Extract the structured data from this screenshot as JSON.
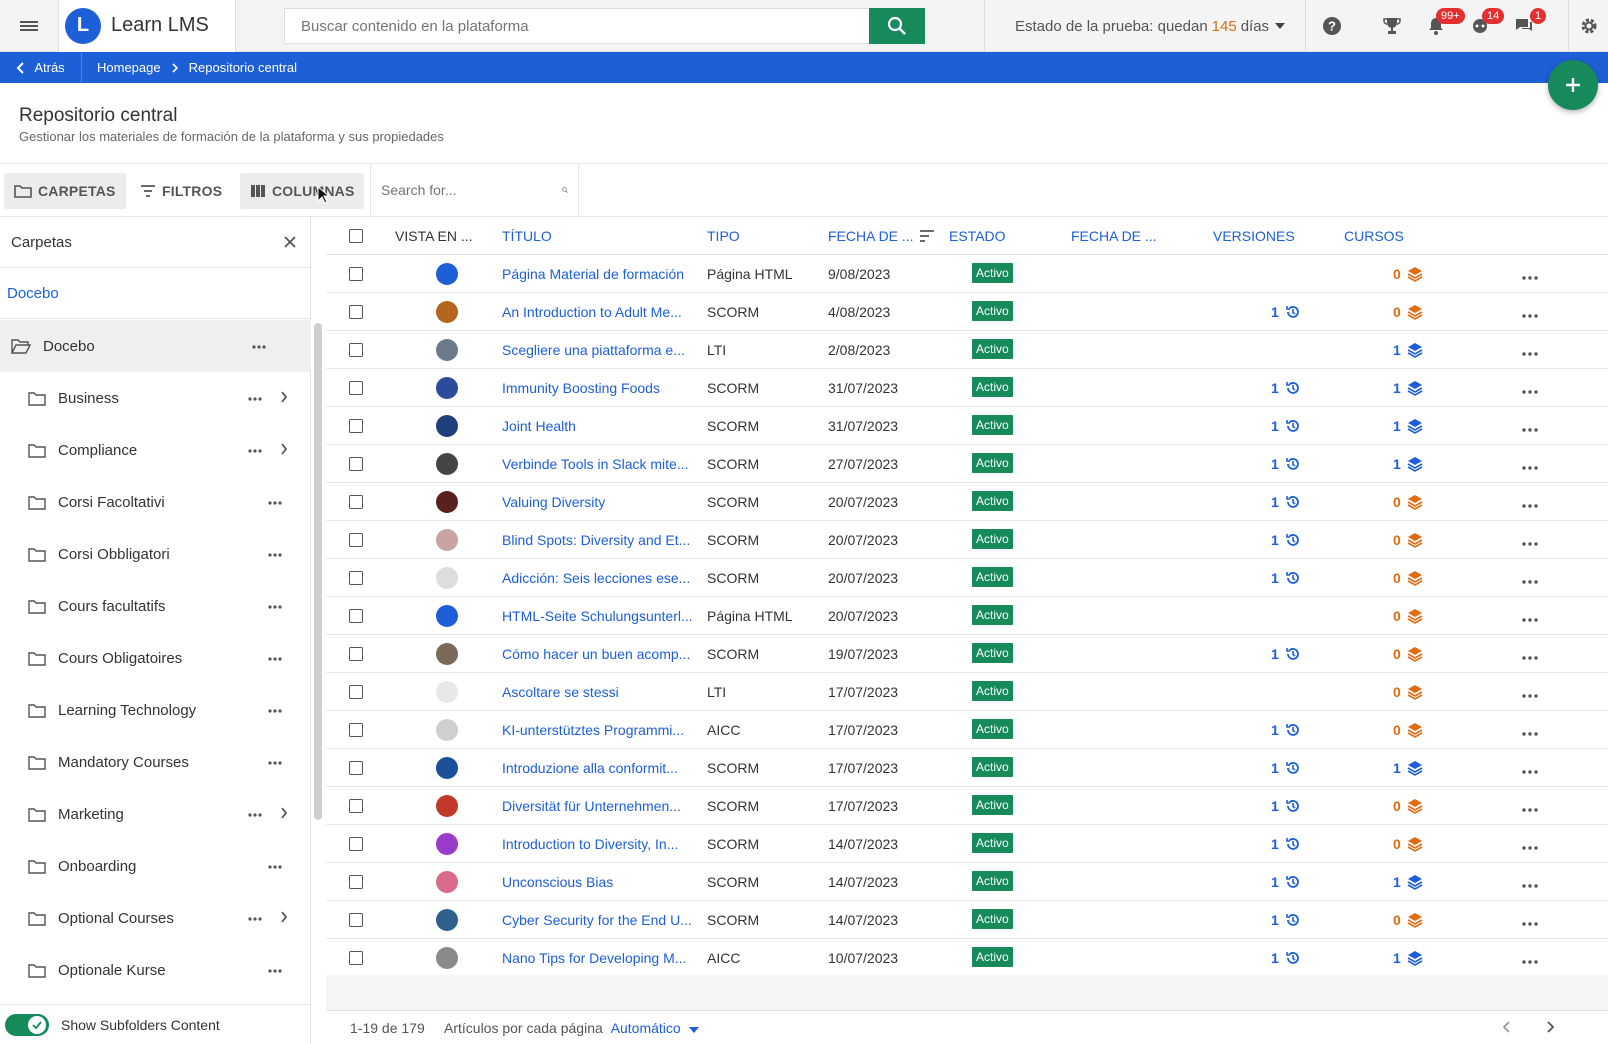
{
  "app": {
    "brand_name": "Learn LMS",
    "logo_letter": "L",
    "search_placeholder": "Buscar contenido en la plataforma",
    "trial_prefix": "Estado de la prueba: quedan",
    "trial_days": "145",
    "trial_suffix": "días",
    "badges": {
      "notifications": "99+",
      "messages_a": "14",
      "messages_b": "1"
    }
  },
  "breadcrumb": {
    "back": "Atrás",
    "home": "Homepage",
    "current": "Repositorio central"
  },
  "page": {
    "title": "Repositorio central",
    "subtitle": "Gestionar los materiales de formación de la plataforma y sus propiedades"
  },
  "toolbar": {
    "folders": "CARPETAS",
    "filters": "FILTROS",
    "columns": "COLUMNAS",
    "search_placeholder": "Search for..."
  },
  "sidebar": {
    "title": "Carpetas",
    "root_link": "Docebo",
    "root_folder": "Docebo",
    "folders": [
      {
        "name": "Business",
        "has_children": true
      },
      {
        "name": "Compliance",
        "has_children": true
      },
      {
        "name": "Corsi Facoltativi",
        "has_children": false
      },
      {
        "name": "Corsi Obbligatori",
        "has_children": false
      },
      {
        "name": "Cours facultatifs",
        "has_children": false
      },
      {
        "name": "Cours Obligatoires",
        "has_children": false
      },
      {
        "name": "Learning Technology",
        "has_children": false
      },
      {
        "name": "Mandatory Courses",
        "has_children": false
      },
      {
        "name": "Marketing",
        "has_children": true
      },
      {
        "name": "Onboarding",
        "has_children": false
      },
      {
        "name": "Optional Courses",
        "has_children": true
      },
      {
        "name": "Optionale Kurse",
        "has_children": false
      }
    ],
    "toggle_label": "Show Subfolders Content"
  },
  "table": {
    "columns": {
      "preview": "VISTA EN ...",
      "title": "TÍTULO",
      "type": "TIPO",
      "date": "FECHA DE ...",
      "status": "ESTADO",
      "date2": "FECHA DE ...",
      "versions": "VERSIONES",
      "courses": "CURSOS"
    },
    "rows": [
      {
        "title": "Página Material de formación",
        "type": "Página HTML",
        "date": "9/08/2023",
        "status": "Activo",
        "versions": "",
        "courses": "0",
        "thumb": "#1d5fd6"
      },
      {
        "title": "An Introduction to Adult Me...",
        "type": "SCORM",
        "date": "4/08/2023",
        "status": "Activo",
        "versions": "1",
        "courses": "0",
        "thumb": "#b5651d"
      },
      {
        "title": "Scegliere una piattaforma e...",
        "type": "LTI",
        "date": "2/08/2023",
        "status": "Activo",
        "versions": "",
        "courses": "1",
        "thumb": "#6c7a89"
      },
      {
        "title": "Immunity Boosting Foods",
        "type": "SCORM",
        "date": "31/07/2023",
        "status": "Activo",
        "versions": "1",
        "courses": "1",
        "thumb": "#2b4c9b"
      },
      {
        "title": "Joint Health",
        "type": "SCORM",
        "date": "31/07/2023",
        "status": "Activo",
        "versions": "1",
        "courses": "1",
        "thumb": "#1f3f7a"
      },
      {
        "title": "Verbinde Tools in Slack mite...",
        "type": "SCORM",
        "date": "27/07/2023",
        "status": "Activo",
        "versions": "1",
        "courses": "1",
        "thumb": "#444"
      },
      {
        "title": "Valuing Diversity",
        "type": "SCORM",
        "date": "20/07/2023",
        "status": "Activo",
        "versions": "1",
        "courses": "0",
        "thumb": "#5a1f1f"
      },
      {
        "title": "Blind Spots: Diversity and Et...",
        "type": "SCORM",
        "date": "20/07/2023",
        "status": "Activo",
        "versions": "1",
        "courses": "0",
        "thumb": "#c9a2a2"
      },
      {
        "title": "Adicción: Seis lecciones ese...",
        "type": "SCORM",
        "date": "20/07/2023",
        "status": "Activo",
        "versions": "1",
        "courses": "0",
        "thumb": "#ddd"
      },
      {
        "title": "HTML-Seite Schulungsunterl...",
        "type": "Página HTML",
        "date": "20/07/2023",
        "status": "Activo",
        "versions": "",
        "courses": "0",
        "thumb": "#1d5fd6"
      },
      {
        "title": "Cómo hacer un buen acomp...",
        "type": "SCORM",
        "date": "19/07/2023",
        "status": "Activo",
        "versions": "1",
        "courses": "0",
        "thumb": "#7a6a5a"
      },
      {
        "title": "Ascoltare se stessi",
        "type": "LTI",
        "date": "17/07/2023",
        "status": "Activo",
        "versions": "",
        "courses": "0",
        "thumb": "#e8e8e8"
      },
      {
        "title": "KI-unterstütztes Programmi...",
        "type": "AICC",
        "date": "17/07/2023",
        "status": "Activo",
        "versions": "1",
        "courses": "0",
        "thumb": "#cfcfcf"
      },
      {
        "title": "Introduzione alla conformit...",
        "type": "SCORM",
        "date": "17/07/2023",
        "status": "Activo",
        "versions": "1",
        "courses": "1",
        "thumb": "#1f4f9a"
      },
      {
        "title": "Diversität für Unternehmen...",
        "type": "SCORM",
        "date": "17/07/2023",
        "status": "Activo",
        "versions": "1",
        "courses": "0",
        "thumb": "#c0392b"
      },
      {
        "title": "Introduction to Diversity, In...",
        "type": "SCORM",
        "date": "14/07/2023",
        "status": "Activo",
        "versions": "1",
        "courses": "0",
        "thumb": "#9b3bc9"
      },
      {
        "title": "Unconscious Bias",
        "type": "SCORM",
        "date": "14/07/2023",
        "status": "Activo",
        "versions": "1",
        "courses": "1",
        "thumb": "#d96b8a"
      },
      {
        "title": "Cyber Security for the End U...",
        "type": "SCORM",
        "date": "14/07/2023",
        "status": "Activo",
        "versions": "1",
        "courses": "0",
        "thumb": "#2f5f8a"
      },
      {
        "title": "Nano Tips for Developing M...",
        "type": "AICC",
        "date": "10/07/2023",
        "status": "Activo",
        "versions": "1",
        "courses": "1",
        "thumb": "#8a8a8a"
      }
    ]
  },
  "pagination": {
    "range": "1-19 de 179",
    "per_page_label": "Artículos por cada página",
    "per_page_value": "Automático"
  },
  "colors": {
    "primary": "#1d5fd6",
    "success": "#168a5a",
    "warning": "#e06b10",
    "danger": "#e22f2f"
  }
}
